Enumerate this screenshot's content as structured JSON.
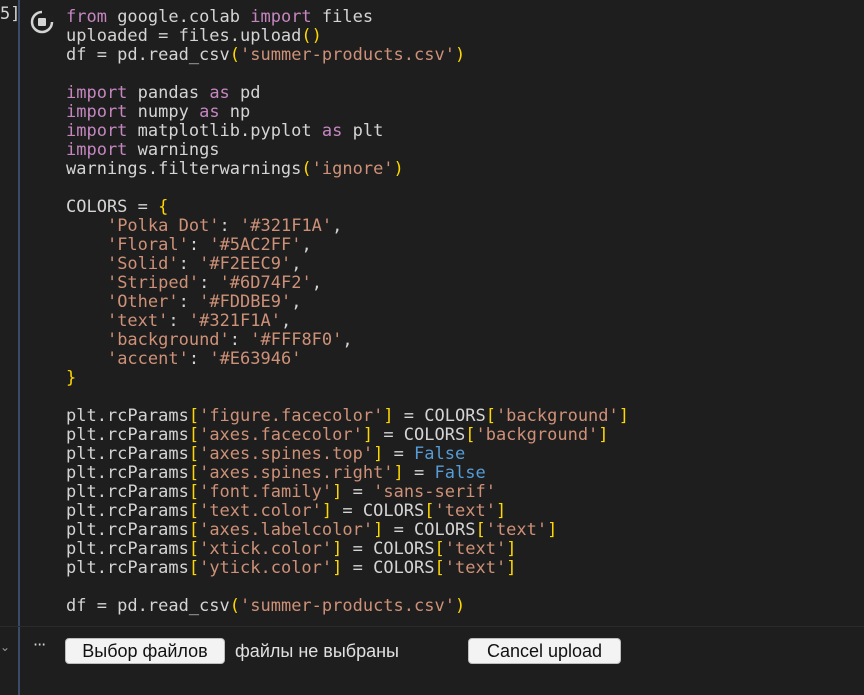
{
  "cell": {
    "execution_count": "5]",
    "run_icon": "run-cell-icon"
  },
  "code": {
    "lines": [
      "from google.colab import files",
      "uploaded = files.upload()",
      "df = pd.read_csv('summer-products.csv')",
      "",
      "import pandas as pd",
      "import numpy as np",
      "import matplotlib.pyplot as plt",
      "import warnings",
      "warnings.filterwarnings('ignore')",
      "",
      "COLORS = {",
      "    'Polka Dot': '#321F1A',",
      "    'Floral': '#5AC2FF',",
      "    'Solid': '#F2EEC9',",
      "    'Striped': '#6D74F2',",
      "    'Other': '#FDDBE9',",
      "    'text': '#321F1A',",
      "    'background': '#FFF8F0',",
      "    'accent': '#E63946'",
      "}",
      "",
      "plt.rcParams['figure.facecolor'] = COLORS['background']",
      "plt.rcParams['axes.facecolor'] = COLORS['background']",
      "plt.rcParams['axes.spines.top'] = False",
      "plt.rcParams['axes.spines.right'] = False",
      "plt.rcParams['font.family'] = 'sans-serif'",
      "plt.rcParams['text.color'] = COLORS['text']",
      "plt.rcParams['axes.labelcolor'] = COLORS['text']",
      "plt.rcParams['xtick.color'] = COLORS['text']",
      "plt.rcParams['ytick.color'] = COLORS['text']",
      "",
      "df = pd.read_csv('summer-products.csv')"
    ]
  },
  "output": {
    "menu_label": "···",
    "choose_files_label": "Выбор файлов",
    "no_files_text": "файлы не выбраны",
    "cancel_upload_label": "Cancel upload"
  },
  "colors": {
    "background": "#1e1e1e",
    "keyword": "#c586c0",
    "string": "#ce9178",
    "bracket": "#ffd700",
    "constant": "#569cd6",
    "text": "#d4d4d4"
  }
}
